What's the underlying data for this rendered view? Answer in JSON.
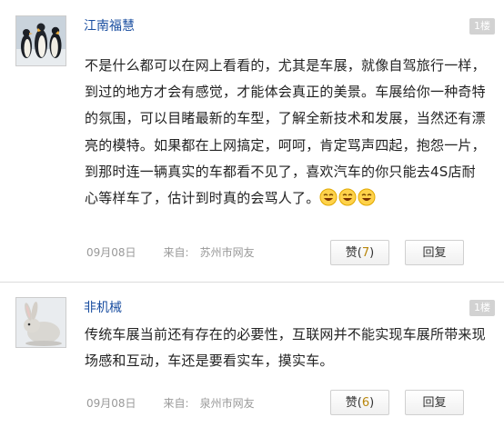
{
  "comments": [
    {
      "user": "江南福慧",
      "floor": "1楼",
      "text": "不是什么都可以在网上看看的，尤其是车展，就像自驾旅行一样，到过的地方才会有感觉，才能体会真正的美景。车展给你一种奇特的氛围，可以目睹最新的车型，了解全新技术和发展，当然还有漂亮的模特。如果都在上网搞定，呵呵，肯定骂声四起，抱怨一片，到那时连一辆真实的车都看不见了，喜欢汽车的你只能去4S店耐心等样车了，估计到时真的会骂人了。",
      "emoji_icon": "laughing-face-icon",
      "date": "09月08日",
      "from_label": "来自:",
      "city": "苏州市网友",
      "like_label": "赞",
      "like_count": "7",
      "reply_label": "回复"
    },
    {
      "user": "非机械",
      "floor": "1楼",
      "text": "传统车展当前还有存在的必要性，互联网并不能实现车展所带来现场感和互动，车还是要看实车，摸实车。",
      "date": "09月08日",
      "from_label": "来自:",
      "city": "泉州市网友",
      "like_label": "赞",
      "like_count": "6",
      "reply_label": "回复"
    }
  ],
  "colors": {
    "username": "#1a4ea0",
    "like_count": "#b8860b",
    "floor_badge": "#d2d2d2"
  }
}
